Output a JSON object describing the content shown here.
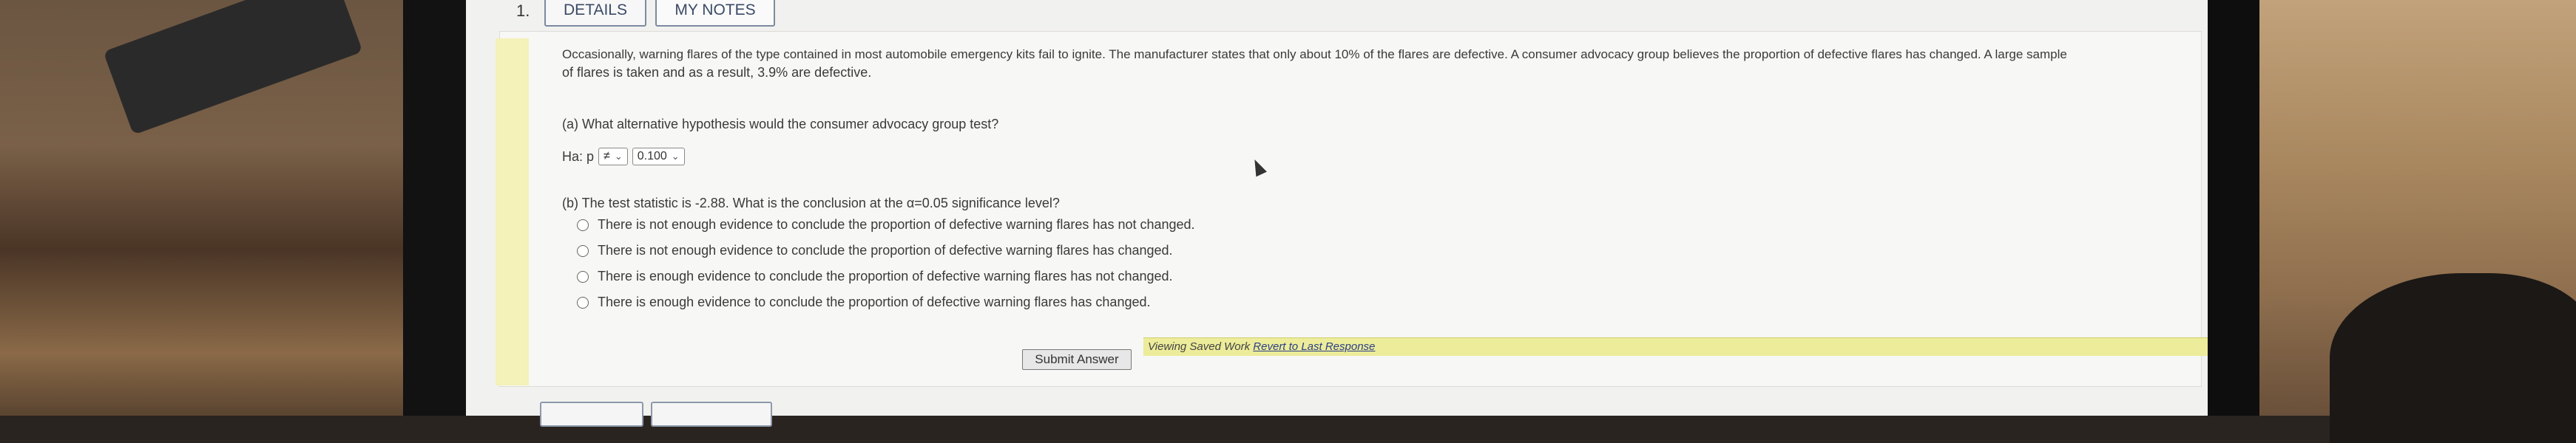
{
  "question": {
    "number": "1.",
    "tabs": {
      "details": "DETAILS",
      "my_notes": "MY NOTES"
    },
    "intro_line1": "Occasionally, warning flares of the type contained in most automobile emergency kits fail to ignite. The manufacturer states that only about 10% of the flares are defective. A consumer advocacy group believes the proportion of defective flares has changed. A large sample",
    "intro_line2": "of flares is taken and as a result, 3.9% are defective.",
    "part_a": "(a) What alternative hypothesis would the consumer advocacy group test?",
    "hypothesis": {
      "label": "Ha: p",
      "operator": "≠",
      "value": "0.100"
    },
    "part_b": "(b) The test statistic is -2.88. What is the conclusion at the α=0.05 significance level?",
    "options": [
      "There is not enough evidence to conclude the proportion of defective warning flares has not changed.",
      "There is not enough evidence to conclude the proportion of defective warning flares has changed.",
      "There is enough evidence to conclude the proportion of defective warning flares has not changed.",
      "There is enough evidence to conclude the proportion of defective warning flares has changed."
    ],
    "submit_label": "Submit Answer",
    "saved_text": "Viewing Saved Work",
    "revert_link": "Revert to Last Response"
  }
}
